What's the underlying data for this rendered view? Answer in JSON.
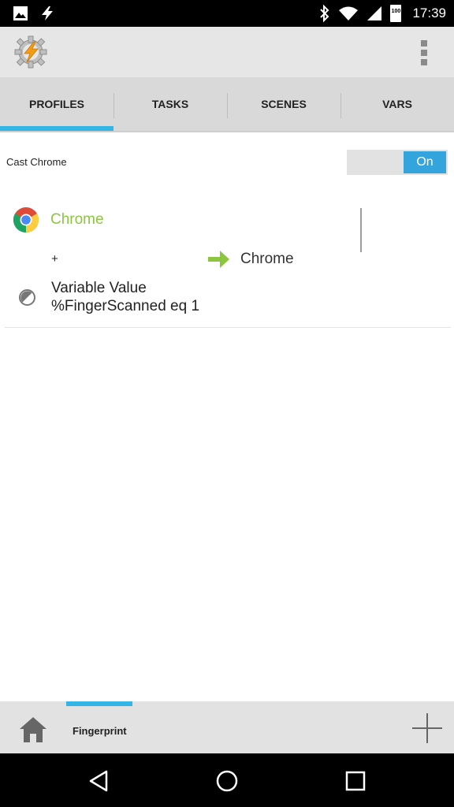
{
  "status_bar": {
    "time": "17:39",
    "battery_level": "100",
    "icons": [
      "image-icon",
      "flash-icon",
      "bluetooth-icon",
      "wifi-icon",
      "signal-icon",
      "battery-icon"
    ]
  },
  "app_bar": {
    "app_icon": "tasker-gear-bolt-icon",
    "menu_icon": "overflow-menu-icon"
  },
  "tabs": [
    {
      "label": "PROFILES",
      "active": true
    },
    {
      "label": "TASKS",
      "active": false
    },
    {
      "label": "SCENES",
      "active": false
    },
    {
      "label": "VARS",
      "active": false
    }
  ],
  "profile": {
    "name": "Cast Chrome",
    "toggle_label": "On",
    "context_app": "Chrome",
    "plus": "+",
    "task_name": "Chrome",
    "state_line1": "Variable Value",
    "state_line2": "%FingerScanned eq 1"
  },
  "project_bar": {
    "project_name": "Fingerprint",
    "home_icon": "home-icon",
    "add_icon": "add-icon"
  },
  "nav_bar": {
    "buttons": [
      "back-icon",
      "home-circle-icon",
      "recents-icon"
    ]
  },
  "colors": {
    "accent": "#33b5e5",
    "toggle_on": "#33a5dc",
    "chrome_green": "#8cc63f"
  }
}
